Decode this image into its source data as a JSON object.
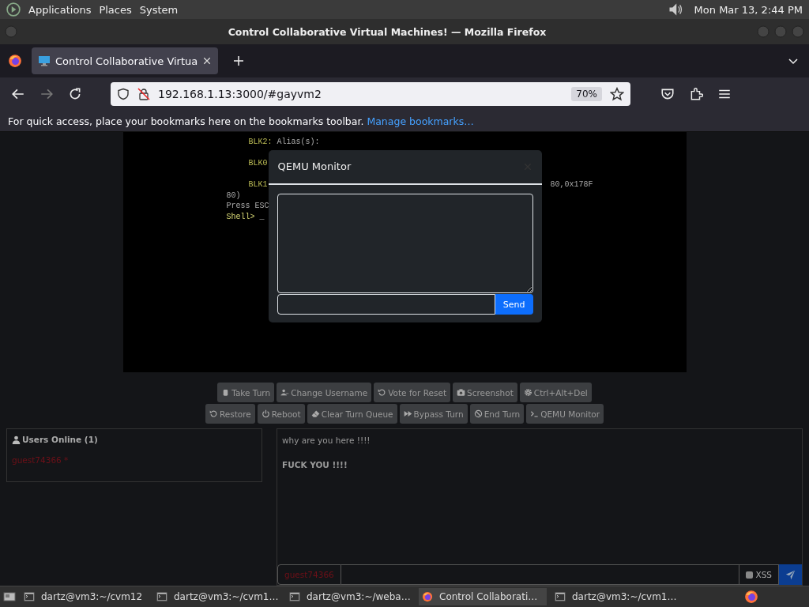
{
  "panel": {
    "menus": [
      "Applications",
      "Places",
      "System"
    ],
    "clock": "Mon Mar 13,  2:44 PM"
  },
  "window": {
    "title": "Control Collaborative Virtual Machines! — Mozilla Firefox"
  },
  "tabs": [
    {
      "label": "Control Collaborative Virtua",
      "selected": true
    }
  ],
  "address_bar": {
    "url": "192.168.1.13:3000/#gayvm2",
    "zoom": "70%"
  },
  "bookmarks_bar": {
    "text": "For quick access, place your bookmarks here on the bookmarks toolbar.",
    "link": "Manage bookmarks…"
  },
  "vm_screen": {
    "lines": [
      {
        "kind": "entry",
        "label": "BLK2:",
        "text": "Alias(s):"
      },
      {
        "kind": "gap"
      },
      {
        "kind": "entry",
        "label": "BLK0"
      },
      {
        "kind": "gap"
      },
      {
        "kind": "entry",
        "label": "BLK1",
        "tail": "80,0x178F"
      },
      {
        "kind": "plain",
        "text": "80)"
      },
      {
        "kind": "plain",
        "text": "Press ESC"
      },
      {
        "kind": "prompt",
        "label": "Shell>",
        "text": "_"
      }
    ]
  },
  "qemu_monitor": {
    "title": "QEMU Monitor",
    "send": "Send"
  },
  "controls": [
    [
      {
        "kind": "hand",
        "label": "Take Turn"
      },
      {
        "kind": "user",
        "label": "Change Username"
      },
      {
        "kind": "undo",
        "label": "Vote for Reset"
      },
      {
        "kind": "camera",
        "label": "Screenshot"
      },
      {
        "kind": "gear",
        "label": "Ctrl+Alt+Del"
      }
    ],
    [
      {
        "kind": "undo",
        "label": "Restore"
      },
      {
        "kind": "power",
        "label": "Reboot"
      },
      {
        "kind": "eraser",
        "label": "Clear Turn Queue"
      },
      {
        "kind": "forward",
        "label": "Bypass Turn"
      },
      {
        "kind": "ban",
        "label": "End Turn"
      },
      {
        "kind": "terminal",
        "label": "QEMU Monitor"
      }
    ]
  ],
  "users_panel": {
    "title": "Users Online (1)",
    "users": [
      "guest74366 *"
    ]
  },
  "chat": {
    "messages": [
      {
        "text": "why are you here !!!!",
        "bold": false
      },
      {
        "text": "FUCK YOU !!!!",
        "bold": true
      }
    ],
    "username": "guest74366",
    "xss": {
      "label": "XSS",
      "checked": false
    }
  },
  "taskbar": [
    {
      "kind": "terminal",
      "label": "dartz@vm3:~/cvm12",
      "selected": false
    },
    {
      "kind": "terminal",
      "label": "dartz@vm3:~/cvm1…",
      "selected": false
    },
    {
      "kind": "terminal",
      "label": "dartz@vm3:~/weba…",
      "selected": false
    },
    {
      "kind": "firefox",
      "label": "Control Collaborati…",
      "selected": true
    },
    {
      "kind": "terminal",
      "label": "dartz@vm3:~/cvm1…",
      "selected": false
    }
  ]
}
